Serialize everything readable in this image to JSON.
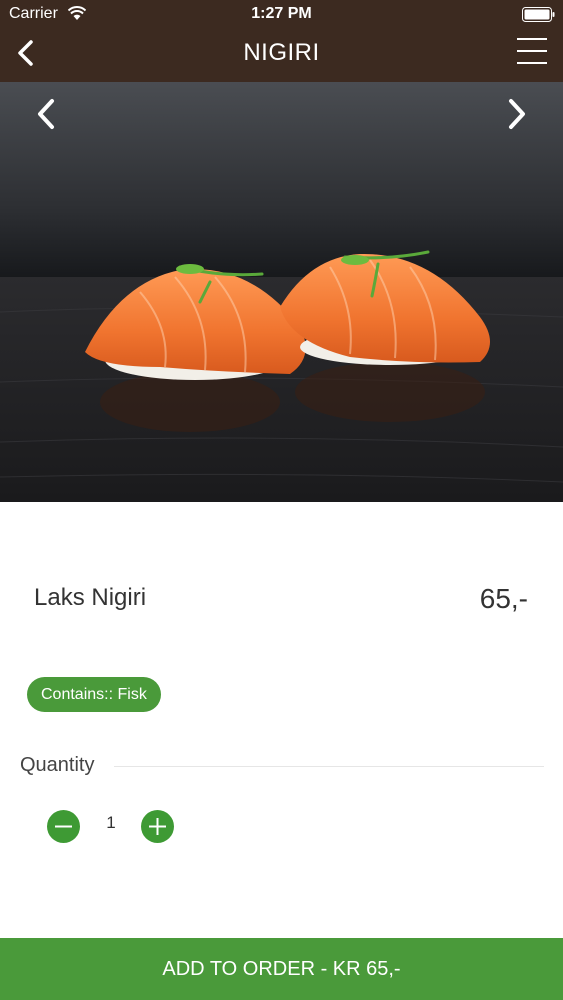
{
  "status_bar": {
    "carrier": "Carrier",
    "time": "1:27 PM"
  },
  "nav": {
    "title": "NIGIRI",
    "back_icon": "chevron-left-icon",
    "menu_icon": "hamburger-menu-icon"
  },
  "hero": {
    "prev_icon": "chevron-left-icon",
    "next_icon": "chevron-right-icon"
  },
  "product": {
    "name": "Laks Nigiri",
    "price": "65,-",
    "tag": "Contains:: Fisk"
  },
  "quantity": {
    "label": "Quantity",
    "value": "1"
  },
  "add_to_order": {
    "label": "ADD TO ORDER - KR 65,-"
  },
  "colors": {
    "header_bg": "#3c2a20",
    "accent_green": "#4a9a3a"
  }
}
